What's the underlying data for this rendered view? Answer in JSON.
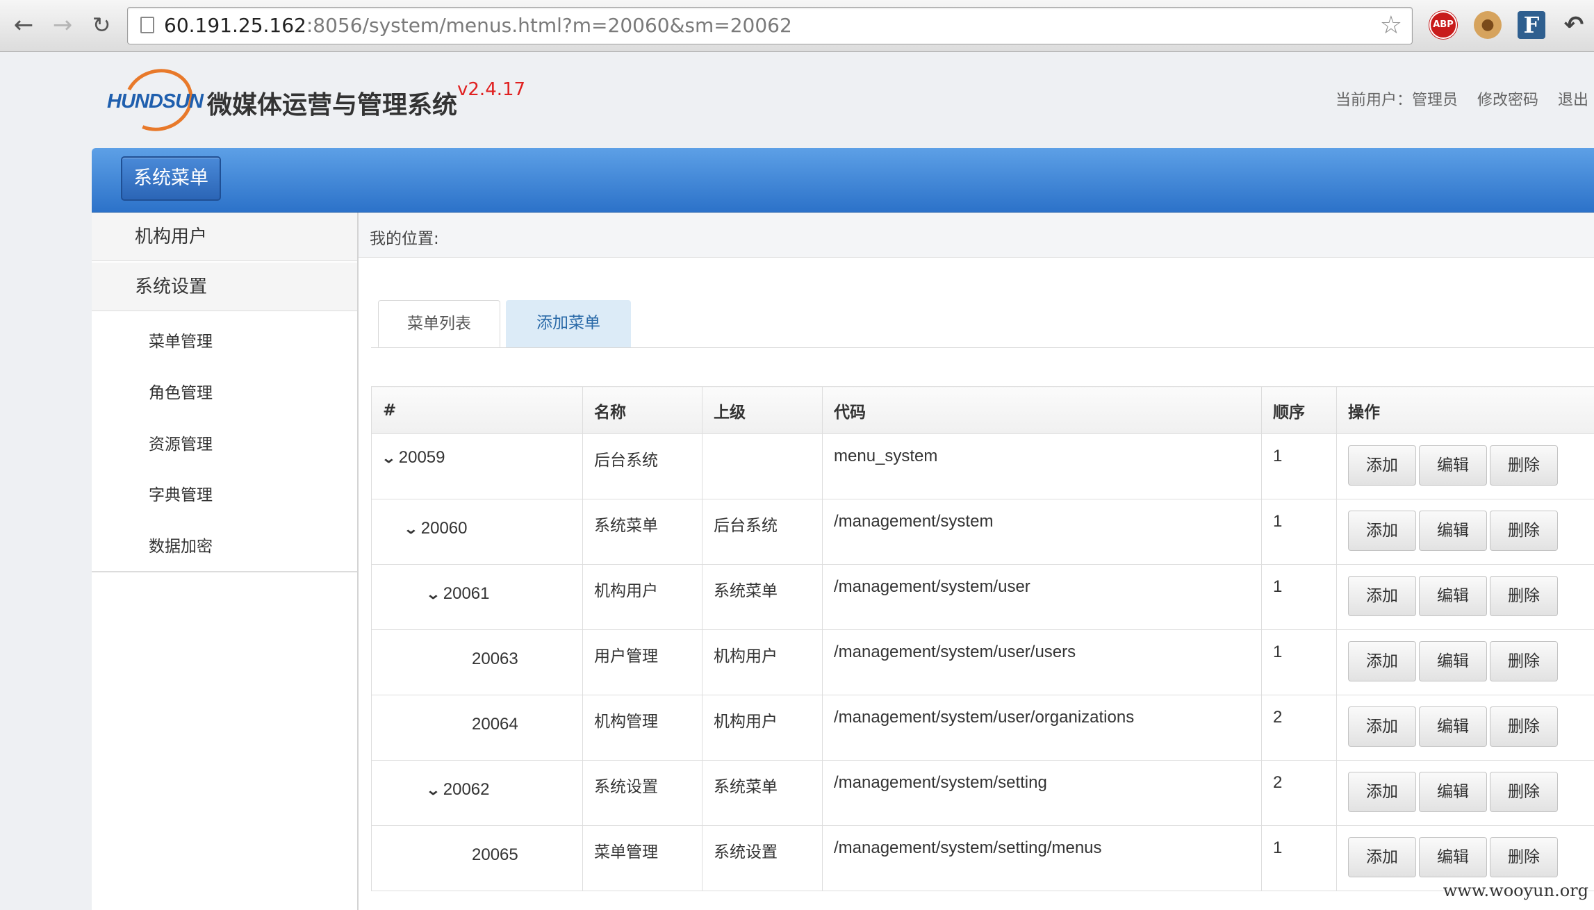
{
  "browser": {
    "url_host": "60.191.25.162",
    "url_rest": ":8056/system/menus.html?m=20060&sm=20062",
    "ext_abp": "ABP",
    "ext_f": "F",
    "back_icon": "arrow-left-icon",
    "forward_icon": "arrow-right-icon",
    "reload_icon": "reload-icon",
    "star_icon": "star-icon"
  },
  "header": {
    "logo_text": "HUNDSUN",
    "system_title": "微媒体运营与管理系统",
    "version": "v2.4.17",
    "current_user_label": "当前用户：",
    "current_user": "管理员",
    "change_password": "修改密码",
    "logout": "退出"
  },
  "top_menu": {
    "active_tab": "系统菜单"
  },
  "sidebar": {
    "groups": [
      {
        "label": "机构用户"
      },
      {
        "label": "系统设置"
      }
    ],
    "items": [
      {
        "label": "菜单管理"
      },
      {
        "label": "角色管理"
      },
      {
        "label": "资源管理"
      },
      {
        "label": "字典管理"
      },
      {
        "label": "数据加密"
      }
    ]
  },
  "breadcrumb": {
    "label": "我的位置:"
  },
  "tabs": [
    {
      "label": "菜单列表",
      "active": true
    },
    {
      "label": "添加菜单",
      "active": false
    }
  ],
  "table": {
    "headers": [
      "#",
      "名称",
      "上级",
      "代码",
      "顺序",
      "操作"
    ],
    "buttons": {
      "add": "添加",
      "edit": "编辑",
      "delete": "删除"
    },
    "rows": [
      {
        "id": "20059",
        "name": "后台系统",
        "parent": "",
        "code": "menu_system",
        "order": "1"
      },
      {
        "id": "20060",
        "name": "系统菜单",
        "parent": "后台系统",
        "code": "/management/system",
        "order": "1"
      },
      {
        "id": "20061",
        "name": "机构用户",
        "parent": "系统菜单",
        "code": "/management/system/user",
        "order": "1"
      },
      {
        "id": "20063",
        "name": "用户管理",
        "parent": "机构用户",
        "code": "/management/system/user/users",
        "order": "1"
      },
      {
        "id": "20064",
        "name": "机构管理",
        "parent": "机构用户",
        "code": "/management/system/user/organizations",
        "order": "2"
      },
      {
        "id": "20062",
        "name": "系统设置",
        "parent": "系统菜单",
        "code": "/management/system/setting",
        "order": "2"
      },
      {
        "id": "20065",
        "name": "菜单管理",
        "parent": "系统设置",
        "code": "/management/system/setting/menus",
        "order": "1"
      }
    ]
  },
  "watermark": "www.wooyun.org"
}
